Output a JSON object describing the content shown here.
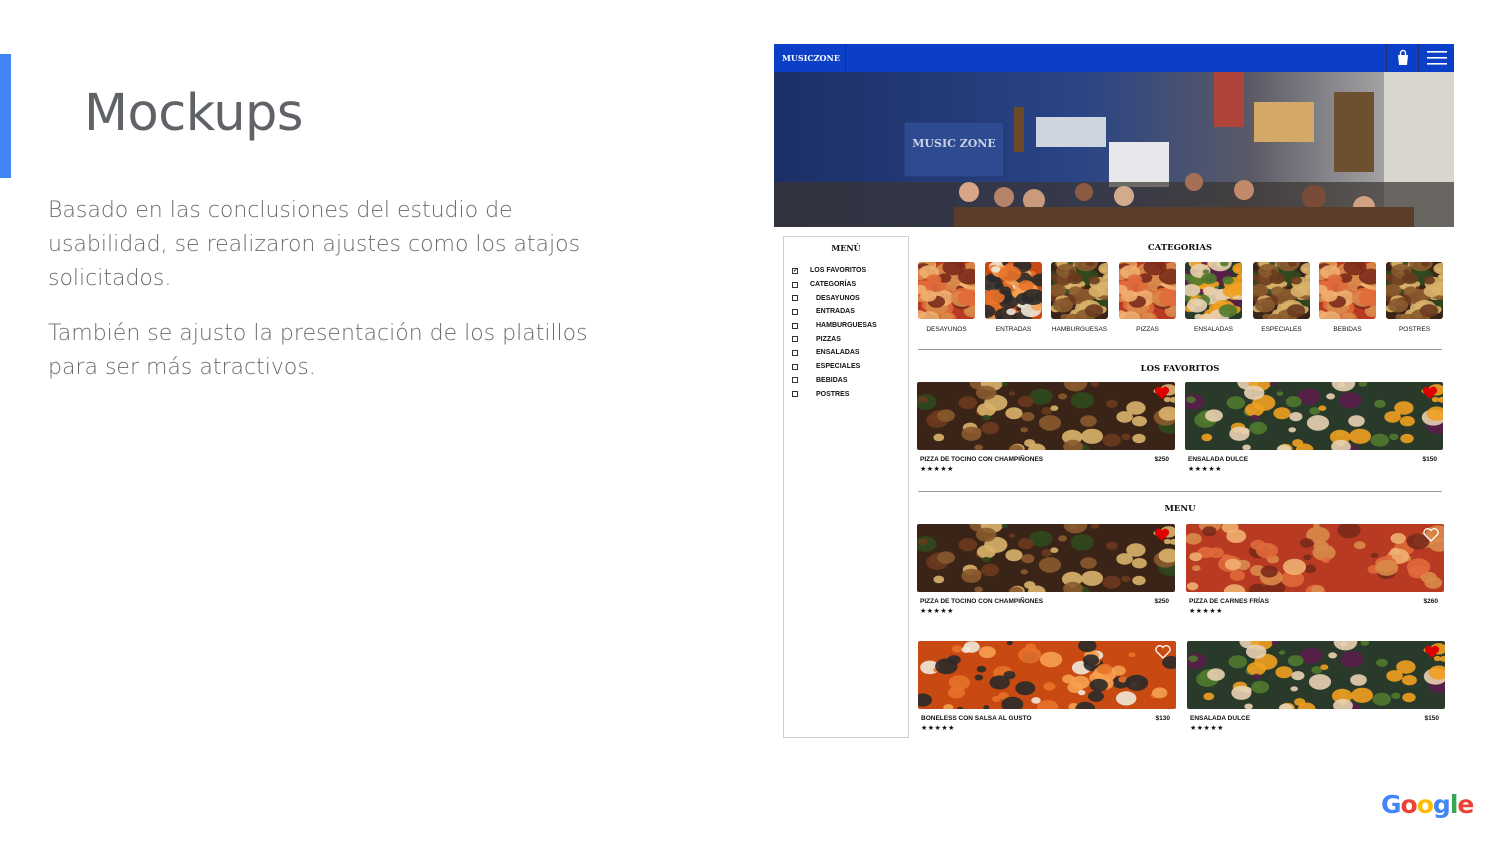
{
  "slide": {
    "title": "Mockups",
    "paragraphs": [
      "Basado en las conclusiones del estudio de usabilidad, se realizaron ajustes como los atajos solicitados.",
      "También se ajusto la presentación de los platillos para ser más atractivos."
    ],
    "accent_color": "#4285f4",
    "footer_logo": [
      "G",
      "o",
      "o",
      "g",
      "l",
      "e"
    ],
    "footer_logo_colors": [
      "#4285f4",
      "#ea4335",
      "#fbbc05",
      "#4285f4",
      "#34a853",
      "#ea4335"
    ]
  },
  "mockup": {
    "brand": "MUSICZONE",
    "nav_color": "#0b3fc8",
    "hero_sign": "MUSIC ZONE",
    "sidebar": {
      "title": "MENÚ",
      "items": [
        {
          "label": "LOS FAVORITOS",
          "checked": true,
          "sub": false
        },
        {
          "label": "CATEGORÍAS",
          "checked": false,
          "sub": false
        },
        {
          "label": "DESAYUNOS",
          "checked": false,
          "sub": true
        },
        {
          "label": "ENTRADAS",
          "checked": false,
          "sub": true
        },
        {
          "label": "HAMBURGUESAS",
          "checked": false,
          "sub": true
        },
        {
          "label": "PIZZAS",
          "checked": false,
          "sub": true
        },
        {
          "label": "ENSALADAS",
          "checked": false,
          "sub": true
        },
        {
          "label": "ESPECIALES",
          "checked": false,
          "sub": true
        },
        {
          "label": "BEBIDAS",
          "checked": false,
          "sub": true
        },
        {
          "label": "POSTRES",
          "checked": false,
          "sub": true
        }
      ]
    },
    "categories_title": "CATEGORIAS",
    "categories": [
      {
        "label": "DESAYUNOS",
        "color": "#d9783a"
      },
      {
        "label": "ENTRADAS",
        "color": "#c9581e"
      },
      {
        "label": "HAMBURGUESAS",
        "color": "#8a4a26"
      },
      {
        "label": "PIZZAS",
        "color": "#b9522a"
      },
      {
        "label": "ENSALADAS",
        "color": "#3d6b3a"
      },
      {
        "label": "ESPECIALES",
        "color": "#a88a2e"
      },
      {
        "label": "BEBIDAS",
        "color": "#b02a2a"
      },
      {
        "label": "POSTRES",
        "color": "#8a4b3a"
      }
    ],
    "favorites_title": "LOS FAVORITOS",
    "favorites": [
      {
        "name": "PIZZA DE TOCINO CON CHAMPIÑONES",
        "price": "$250",
        "stars": "★★★★★",
        "liked": true,
        "img": "pizza"
      },
      {
        "name": "ENSALADA DULCE",
        "price": "$150",
        "stars": "★★★★★",
        "liked": true,
        "img": "salad"
      }
    ],
    "menu_title": "MENU",
    "menu": [
      {
        "name": "PIZZA DE TOCINO CON CHAMPIÑONES",
        "price": "$250",
        "stars": "★★★★★",
        "liked": true,
        "img": "pizza"
      },
      {
        "name": "PIZZA DE CARNES FRÍAS",
        "price": "$260",
        "stars": "★★★★★",
        "liked": false,
        "img": "pizza2"
      },
      {
        "name": "BONELESS CON SALSA AL GUSTO",
        "price": "$130",
        "stars": "★★★★★",
        "liked": false,
        "img": "boneless"
      },
      {
        "name": "ENSALADA DULCE",
        "price": "$150",
        "stars": "★★★★★",
        "liked": true,
        "img": "salad"
      }
    ]
  }
}
